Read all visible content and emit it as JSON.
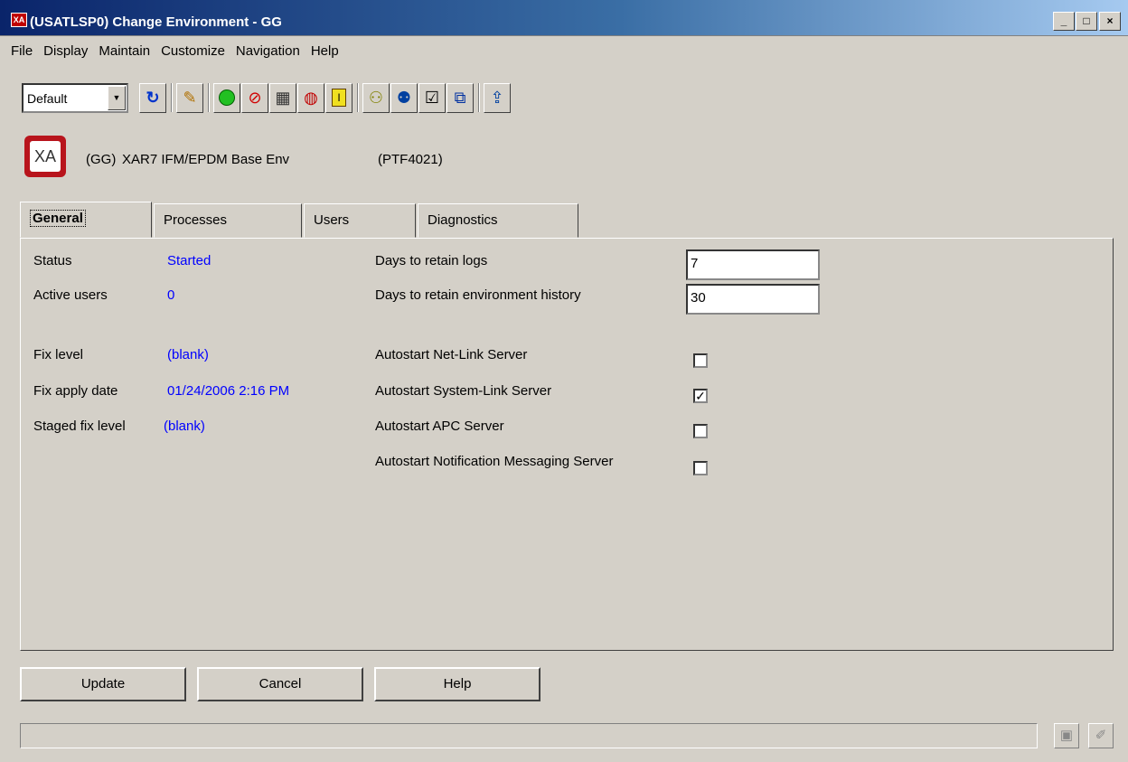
{
  "window": {
    "title": "(USATLSP0) Change Environment - GG",
    "icon_text": "XA",
    "minimize": "_",
    "maximize": "□",
    "close": "×"
  },
  "menu": [
    "File",
    "Display",
    "Maintain",
    "Customize",
    "Navigation",
    "Help"
  ],
  "toolbar": {
    "view_select": "Default",
    "buttons": [
      "refresh-icon",
      "edit-pencil-icon",
      "start-green-icon",
      "stop-red-icon",
      "server-icon",
      "lock-icon",
      "info-icon",
      "tree-icon",
      "users-icon",
      "checklist-icon",
      "windows-icon",
      "export-icon"
    ]
  },
  "header": {
    "logo_text": "XA",
    "env_code": "(GG)",
    "env_name": "XAR7 IFM/EPDM Base Env",
    "ptf": "(PTF4021)"
  },
  "tabs": [
    "General",
    "Processes",
    "Users",
    "Diagnostics"
  ],
  "general": {
    "status_label": "Status",
    "status_value": "Started",
    "active_users_label": "Active users",
    "active_users_value": "0",
    "fix_level_label": "Fix level",
    "fix_level_value": "(blank)",
    "fix_apply_date_label": "Fix apply date",
    "fix_apply_date_value": "01/24/2006 2:16 PM",
    "staged_fix_level_label": "Staged fix level",
    "staged_fix_level_value": "(blank)",
    "days_logs_label": "Days to retain logs",
    "days_logs_value": "7",
    "days_history_label": "Days to retain environment history",
    "days_history_value": "30",
    "autostart_netlink_label": "Autostart Net-Link Server",
    "autostart_netlink_checked": false,
    "autostart_systemlink_label": "Autostart System-Link Server",
    "autostart_systemlink_checked": true,
    "autostart_apc_label": "Autostart APC Server",
    "autostart_apc_checked": false,
    "autostart_notification_label": "Autostart Notification Messaging Server",
    "autostart_notification_checked": false
  },
  "buttons": {
    "update": "Update",
    "cancel": "Cancel",
    "help": "Help"
  }
}
